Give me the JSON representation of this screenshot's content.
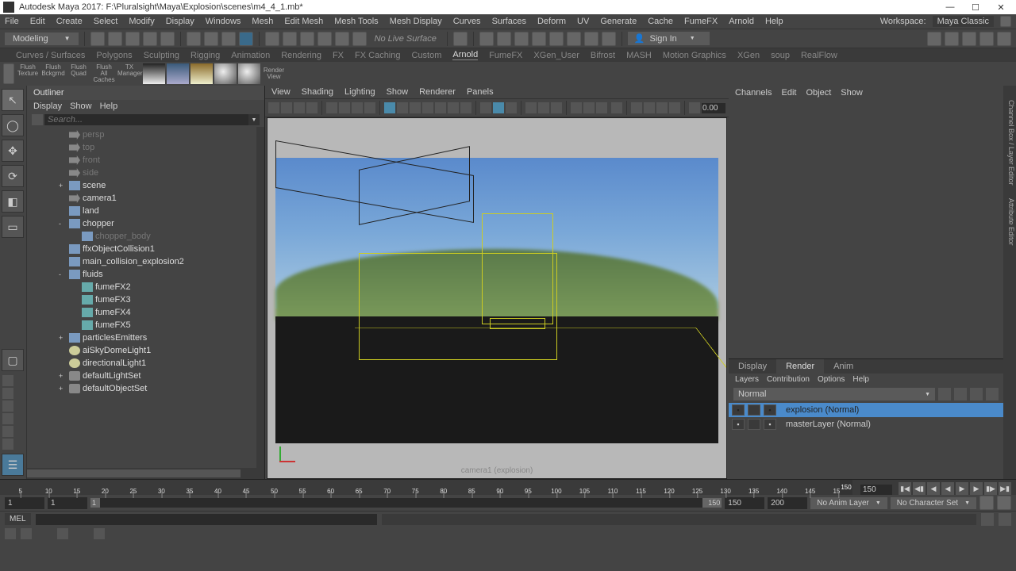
{
  "title": "Autodesk Maya 2017: F:\\Pluralsight\\Maya\\Explosion\\scenes\\m4_4_1.mb*",
  "menus": [
    "File",
    "Edit",
    "Create",
    "Select",
    "Modify",
    "Display",
    "Windows",
    "Mesh",
    "Edit Mesh",
    "Mesh Tools",
    "Mesh Display",
    "Curves",
    "Surfaces",
    "Deform",
    "UV",
    "Generate",
    "Cache",
    "FumeFX",
    "Arnold",
    "Help"
  ],
  "workspace": {
    "label": "Workspace:",
    "value": "Maya Classic"
  },
  "modeDropdown": "Modeling",
  "noLive": "No Live Surface",
  "signIn": "Sign In",
  "shelfTabs": [
    "Curves / Surfaces",
    "Polygons",
    "Sculpting",
    "Rigging",
    "Animation",
    "Rendering",
    "FX",
    "FX Caching",
    "Custom",
    "Arnold",
    "FumeFX",
    "XGen_User",
    "Bifrost",
    "MASH",
    "Motion Graphics",
    "XGen",
    "soup",
    "RealFlow"
  ],
  "shelfActive": "Arnold",
  "shelfItems": [
    {
      "label": "Flush Texture"
    },
    {
      "label": "Flush Bckgrnd"
    },
    {
      "label": "Flush Quad"
    },
    {
      "label": "Flush All Caches"
    },
    {
      "label": "TX Manager"
    }
  ],
  "renderView": "Render View",
  "outliner": {
    "title": "Outliner",
    "menus": [
      "Display",
      "Show",
      "Help"
    ],
    "searchPlaceholder": "Search...",
    "items": [
      {
        "name": "persp",
        "icon": "cam",
        "dim": true,
        "indent": 0
      },
      {
        "name": "top",
        "icon": "cam",
        "dim": true,
        "indent": 0
      },
      {
        "name": "front",
        "icon": "cam",
        "dim": true,
        "indent": 0
      },
      {
        "name": "side",
        "icon": "cam",
        "dim": true,
        "indent": 0
      },
      {
        "name": "scene",
        "icon": "mesh",
        "indent": 0,
        "exp": "+"
      },
      {
        "name": "camera1",
        "icon": "cam",
        "indent": 0
      },
      {
        "name": "land",
        "icon": "mesh",
        "indent": 0
      },
      {
        "name": "chopper",
        "icon": "mesh",
        "indent": 0,
        "exp": "-"
      },
      {
        "name": "chopper_body",
        "icon": "mesh",
        "dim": true,
        "indent": 1
      },
      {
        "name": "ffxObjectCollision1",
        "icon": "mesh",
        "indent": 0
      },
      {
        "name": "main_collision_explosion2",
        "icon": "mesh",
        "indent": 0
      },
      {
        "name": "fluids",
        "icon": "mesh",
        "indent": 0,
        "exp": "-"
      },
      {
        "name": "fumeFX2",
        "icon": "fluid",
        "indent": 1
      },
      {
        "name": "fumeFX3",
        "icon": "fluid",
        "indent": 1
      },
      {
        "name": "fumeFX4",
        "icon": "fluid",
        "indent": 1
      },
      {
        "name": "fumeFX5",
        "icon": "fluid",
        "indent": 1
      },
      {
        "name": "particlesEmitters",
        "icon": "mesh",
        "indent": 0,
        "exp": "+"
      },
      {
        "name": "aiSkyDomeLight1",
        "icon": "light",
        "indent": 0
      },
      {
        "name": "directionalLight1",
        "icon": "light",
        "indent": 0
      },
      {
        "name": "defaultLightSet",
        "icon": "set",
        "indent": 0,
        "exp": "+"
      },
      {
        "name": "defaultObjectSet",
        "icon": "set",
        "indent": 0,
        "exp": "+"
      }
    ]
  },
  "viewport": {
    "menus": [
      "View",
      "Shading",
      "Lighting",
      "Show",
      "Renderer",
      "Panels"
    ],
    "fieldVal": "0.00",
    "label": "camera1 (explosion)"
  },
  "rightPanel": {
    "menus": [
      "Channels",
      "Edit",
      "Object",
      "Show"
    ],
    "tabs": [
      "Display",
      "Render",
      "Anim"
    ],
    "activeTab": "Render",
    "menus2": [
      "Layers",
      "Contribution",
      "Options",
      "Help"
    ],
    "mode": "Normal",
    "layers": [
      {
        "name": "explosion (Normal)",
        "sel": true
      },
      {
        "name": "masterLayer (Normal)",
        "sel": false
      }
    ],
    "sideTabs": [
      "Channel Box / Layer Editor",
      "Attribute Editor"
    ]
  },
  "timeline": {
    "ticks": [
      5,
      10,
      15,
      20,
      25,
      30,
      35,
      40,
      45,
      50,
      55,
      60,
      65,
      70,
      75,
      80,
      85,
      90,
      95,
      100,
      105,
      110,
      115,
      120,
      125,
      130,
      135,
      140,
      145,
      150
    ],
    "current": 150,
    "curField": "150"
  },
  "range": {
    "start1": "1",
    "start2": "1",
    "thumb": "1",
    "end1": "150",
    "end2": "150",
    "end3": "200",
    "animLayer": "No Anim Layer",
    "charSet": "No Character Set"
  },
  "cmd": {
    "label": "MEL"
  }
}
